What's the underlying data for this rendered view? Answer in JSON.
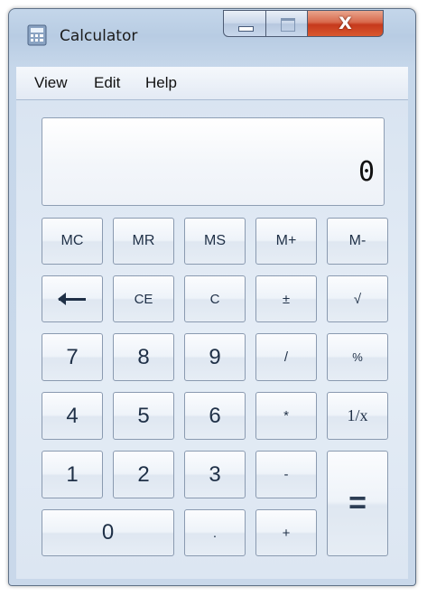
{
  "window": {
    "title": "Calculator",
    "close_glyph": "X"
  },
  "icons": {
    "app": "calculator-icon",
    "minimize": "minimize-icon",
    "maximize": "maximize-icon",
    "close": "close-icon",
    "backspace": "backspace-arrow-icon"
  },
  "menu": [
    "View",
    "Edit",
    "Help"
  ],
  "display": {
    "value": "0"
  },
  "keys": {
    "mc": "MC",
    "mr": "MR",
    "ms": "MS",
    "mplus": "M+",
    "mminus": "M-",
    "ce": "CE",
    "c": "C",
    "plusminus": "±",
    "sqrt": "√",
    "n7": "7",
    "n8": "8",
    "n9": "9",
    "divide": "/",
    "percent": "%",
    "n4": "4",
    "n5": "5",
    "n6": "6",
    "multiply": "*",
    "reciprocal": "1/x",
    "n1": "1",
    "n2": "2",
    "n3": "3",
    "minus": "-",
    "n0": "0",
    "decimal": ".",
    "plus": "+",
    "equals": "="
  },
  "colors": {
    "close_button": "#c6391c",
    "key_text": "#1f3047",
    "window_frame": "#b8cce3"
  }
}
